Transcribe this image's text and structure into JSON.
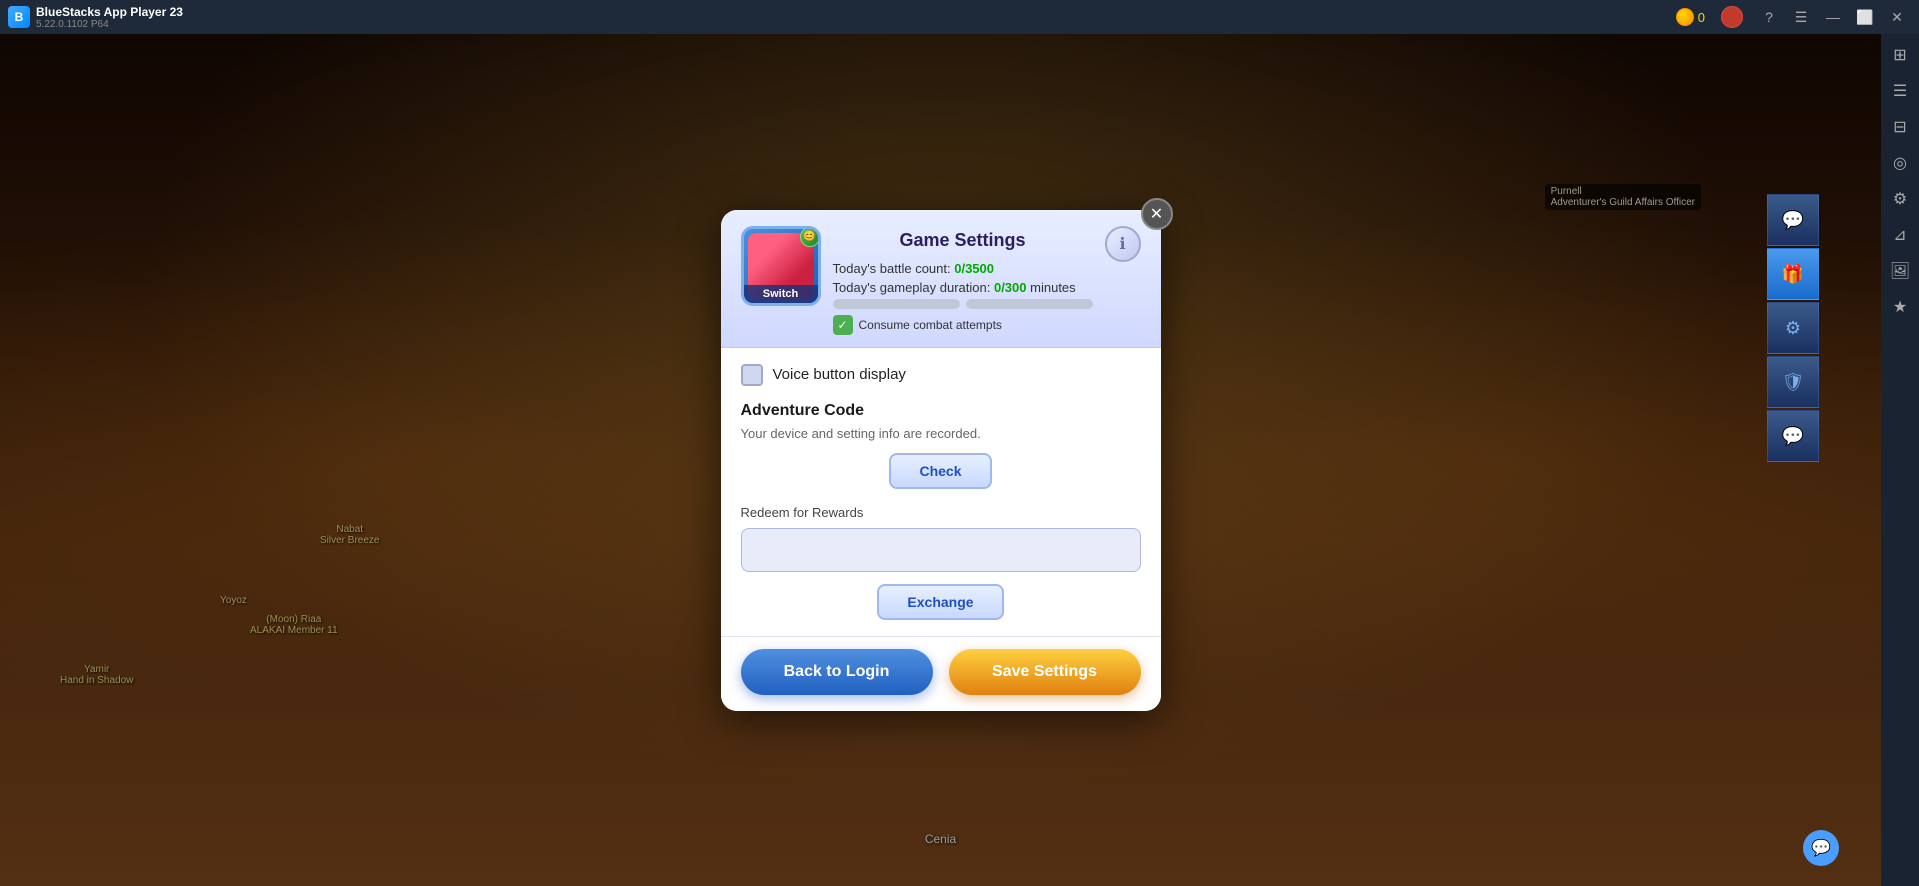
{
  "titlebar": {
    "logo_text": "B",
    "app_name": "BlueStacks App Player 23",
    "version": "5.22.0.1102  P64",
    "coins": "0",
    "nav_back": "←",
    "nav_home": "⌂",
    "nav_copy": "⧉",
    "btn_minimize": "—",
    "btn_restore": "⬜",
    "btn_close": "✕"
  },
  "sidebar": {
    "icons": [
      "⚙",
      "◎",
      "⊞",
      "⊟",
      "⊿"
    ]
  },
  "modal": {
    "title": "Game Settings",
    "close_icon": "✕",
    "character_label": "Switch",
    "stat_battle_label": "Today's battle count: ",
    "stat_battle_value": "0/3500",
    "stat_duration_label": "Today's gameplay duration: ",
    "stat_duration_value": "0/300",
    "stat_duration_unit": " minutes",
    "consume_label": "Consume combat attempts",
    "info_icon": "ℹ",
    "voice_label": "Voice button display",
    "adventure_code_title": "Adventure Code",
    "adventure_code_desc": "Your device and setting info are recorded.",
    "check_btn_label": "Check",
    "redeem_label": "Redeem for Rewards",
    "redeem_placeholder": "",
    "exchange_btn_label": "Exchange",
    "back_btn_label": "Back to Login",
    "save_btn_label": "Save Settings"
  },
  "floating_panel": {
    "btn1_icon": "🖼",
    "btn2_icon": "⚙",
    "btn3_icon": "🛡",
    "btn4_icon": "💬"
  },
  "game": {
    "npc_name": "Purnell",
    "npc_title": "Adventurer's Guild Affairs Officer",
    "char1_name": "Yamir\nHand in Shadow",
    "char2_name": "Yoyoz",
    "char3_name": "Nabat\nSilver Breeze",
    "char4_name": "(Moon) Riaa\nALAKAI Member 11",
    "bottom_char": "Cenia",
    "chat_icon": "💬"
  }
}
